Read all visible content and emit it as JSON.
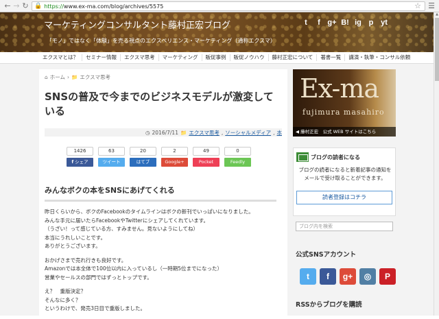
{
  "browser": {
    "url_scheme": "https://",
    "url_rest": "www.ex-ma.com/blog/archives/5575",
    "back_icon": "arrow-left-icon",
    "forward_icon": "arrow-right-icon",
    "reload_icon": "reload-icon"
  },
  "site": {
    "title": "マーケティングコンサルタント藤村正宏ブログ",
    "tagline": "「モノ」ではなく「体験」を売る視点のエクスペリエンス・マーケティング（通称エクスマ）"
  },
  "header_social": [
    "t",
    "f",
    "g+",
    "B!",
    "ig",
    "p",
    "yt"
  ],
  "nav": [
    "エクスマとは？",
    "セミナー情報",
    "エクスマ思考",
    "マーケティング",
    "販促事例",
    "販促ノウハウ",
    "藤村正宏について",
    "著書一覧",
    "講演・執筆・コンサル依頼"
  ],
  "breadcrumb": {
    "home": "ホーム",
    "category": "エクスマ思考"
  },
  "post": {
    "title": "SNSの普及で今までのビジネスモデルが激変している",
    "date": "2016/7/11",
    "categories": [
      "エクスマ思考",
      "ソーシャルメディア",
      "本"
    ]
  },
  "share": [
    {
      "count": "1426",
      "label": "シェア",
      "color": "#3b5998",
      "prefix": "f"
    },
    {
      "count": "63",
      "label": "ツイート",
      "color": "#55acee",
      "prefix": ""
    },
    {
      "count": "20",
      "label": "はてブ",
      "color": "#2c6ebd",
      "prefix": ""
    },
    {
      "count": "2",
      "label": "Google+",
      "color": "#dd4b39",
      "prefix": ""
    },
    {
      "count": "49",
      "label": "Pocket",
      "color": "#ee4056",
      "prefix": ""
    },
    {
      "count": "0",
      "label": "Feedly",
      "color": "#6cc655",
      "prefix": ""
    }
  ],
  "article": {
    "heading": "みんなボクの本をSNSにあげてくれる",
    "paragraphs": [
      [
        "昨日くらいから、ボクのFacebookのタイムラインはボクの新刊でいっぱいになりました。",
        "みんな手元に届いたらFacebookやTwitterにシェアしてくれています。",
        "（うざい！って感じている方、すみません。見ないようにしてね）",
        "本当にうれしいことです。",
        "ありがとうございます。"
      ],
      [
        "おかげさまで売れ行きも良好です。",
        "Amazonでは本全体で100位以内に入っているし（一時期5位までになった）",
        "営業やセールスの部門ではずっとトップです。"
      ],
      [
        "え？　重版決定？",
        "そんなに多く？",
        "というわけで、発売3日目で重版しました。"
      ]
    ]
  },
  "sidebar": {
    "banner_brand": "Ex-ma",
    "banner_sub": "fujimura masahiro",
    "banner_caption": "◀ 藤村正宏　公式 WEB サイトはこちら",
    "reader_title": "ブログの読者になる",
    "reader_desc": "ブログの読者になると新着記事の通知をメールで受け取ることができます。",
    "reader_button": "読者登録はコチラ",
    "search_placeholder": "ブログ内を検索",
    "sns_heading": "公式SNSアカウント",
    "sns": [
      {
        "glyph": "t",
        "color": "#55acee"
      },
      {
        "glyph": "f",
        "color": "#3b5998"
      },
      {
        "glyph": "g+",
        "color": "#dd4b39"
      },
      {
        "glyph": "◎",
        "color": "#517fa4"
      },
      {
        "glyph": "P",
        "color": "#cb2027"
      }
    ],
    "rss_heading": "RSSからブログを購読"
  }
}
